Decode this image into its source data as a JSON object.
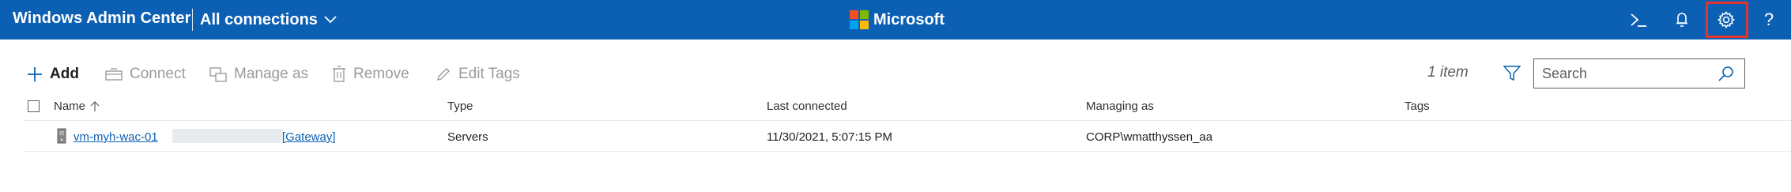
{
  "header": {
    "app_title": "Windows Admin Center",
    "connection_switch": "All connections",
    "brand_name": "Microsoft",
    "brand_colors": [
      "#f25022",
      "#7fba00",
      "#00a4ef",
      "#ffb900"
    ],
    "accent_color": "#0c60b4",
    "icons": [
      "powershell-icon",
      "notifications-icon",
      "settings-icon",
      "help-icon"
    ],
    "help_glyph": "?",
    "highlight_color": "#e4342f"
  },
  "toolbar": {
    "add": "Add",
    "connect": "Connect",
    "manage_as": "Manage as",
    "remove": "Remove",
    "edit_tags": "Edit Tags",
    "item_count": "1 item",
    "search_placeholder": "Search"
  },
  "table": {
    "columns": [
      "Name",
      "Type",
      "Last connected",
      "Managing as",
      "Tags"
    ],
    "sort_column": "Name",
    "rows": [
      {
        "name": "vm-myh-wac-01",
        "name_suffix": "[Gateway]",
        "type": "Servers",
        "last_connected": "11/30/2021, 5:07:15 PM",
        "managing_as": "CORP\\wmatthyssen_aa",
        "tags": ""
      }
    ]
  }
}
